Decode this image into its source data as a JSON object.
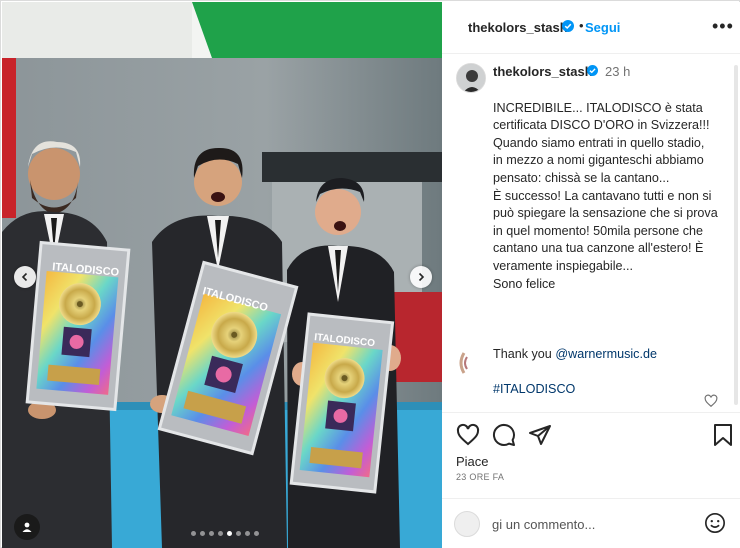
{
  "post": {
    "username": "thekolors_stash",
    "follow_label": "Segui",
    "separator": "•",
    "more_label": "•••",
    "time_ago": "23 h",
    "caption_lines": [
      "INCREDIBILE... ITALODISCO è stata",
      "certificata DISCO D'ORO in Svizzera!!!",
      "Quando siamo entrati in quello stadio,",
      "in mezzo a nomi giganteschi abbiamo",
      "pensato: chissà se la cantano...",
      "È successo! La cantavano tutti e non si",
      "può spiegare la sensazione che si prova",
      "in quel momento! 50mila persone che",
      "cantano una tua canzone all'estero! È",
      "veramente inspiegabile...",
      "Sono felice"
    ],
    "thank_you_text": "Thank you ",
    "mention": "@warnermusic.de",
    "hashtag": "#ITALODISCO",
    "likes_label": "Piace",
    "post_time": "23 ORE FA",
    "comment_placeholder": "gi un commento...",
    "plaque_label": "ITALODISCO",
    "slides_total": 8,
    "slide_active": 5
  },
  "colors": {
    "link_blue": "#0095f6",
    "mention_blue": "#00376b",
    "verified_blue": "#0095f6",
    "meta_gray": "#737373",
    "text_dark": "#262626"
  },
  "icons": {
    "verified": "verified-badge-icon",
    "more": "more-options-icon",
    "like": "heart-icon",
    "comment": "comment-bubble-icon",
    "share": "paper-plane-icon",
    "save": "bookmark-icon",
    "emoji": "smiley-icon",
    "prev": "chevron-left-icon",
    "next": "chevron-right-icon",
    "tag": "user-tag-icon"
  }
}
